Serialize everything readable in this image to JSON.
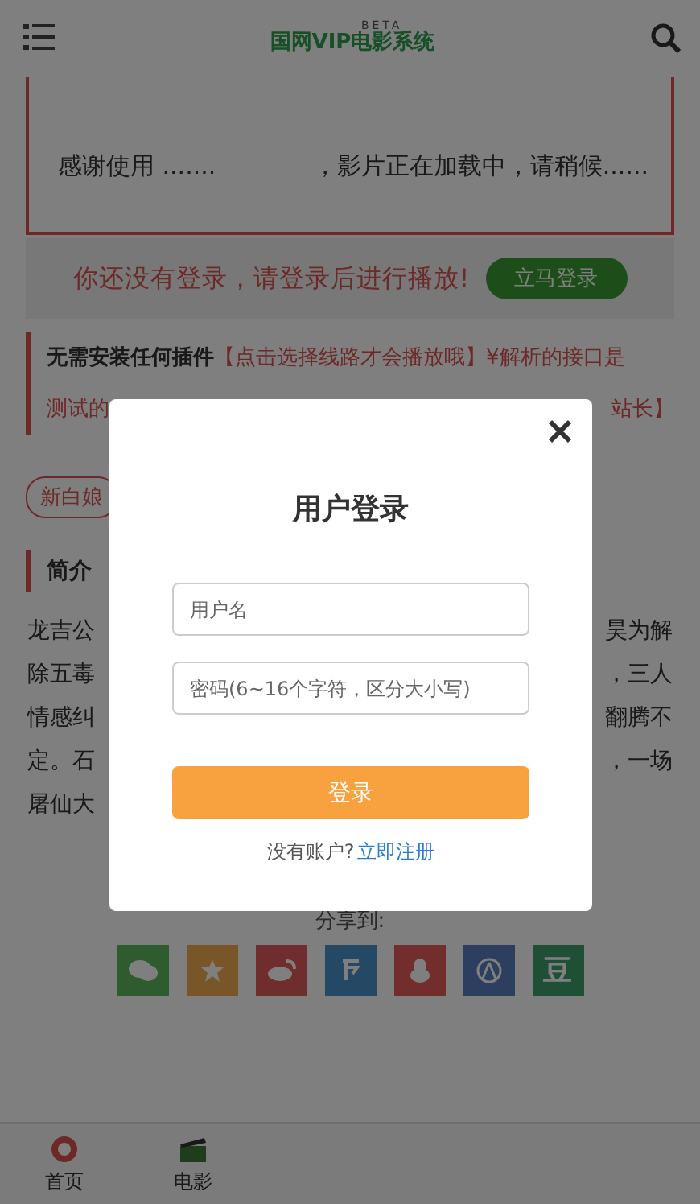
{
  "header": {
    "logo": "国网VIP电影系统",
    "logo_badge": "BETA"
  },
  "player": {
    "message_left": "感谢使用 .......",
    "message_right": "，影片正在加载中，请稍候......"
  },
  "login_bar": {
    "message": "你还没有登录，请登录后进行播放!",
    "button": "立马登录"
  },
  "notice": {
    "lead": "无需安装任何插件",
    "highlight": "【点击选择线路才会播放哦】¥解析的接口是",
    "line2_left": "测试的",
    "line2_right": "站长】"
  },
  "episode_button": "新白娘",
  "intro": {
    "heading": "简介",
    "lines": [
      {
        "left": "龙吉公",
        "right": "昊为解"
      },
      {
        "left": "除五毒",
        "right": "，三人"
      },
      {
        "left": "情感纠",
        "right": "翻腾不"
      },
      {
        "left": "定。石",
        "right": "，一场"
      },
      {
        "left": "屠仙大"
      }
    ]
  },
  "share": {
    "label": "分享到:",
    "items": [
      {
        "kind": "wechat"
      },
      {
        "kind": "qzone"
      },
      {
        "kind": "weibo"
      },
      {
        "kind": "tencent"
      },
      {
        "kind": "qq"
      },
      {
        "kind": "renren"
      },
      {
        "kind": "douban",
        "label": "豆"
      }
    ]
  },
  "bottom_nav": [
    {
      "label": "首页",
      "kind": "home"
    },
    {
      "label": "电影",
      "kind": "movie"
    }
  ],
  "login_modal": {
    "title": "用户登录",
    "username_placeholder": "用户名",
    "password_placeholder": "密码(6~16个字符，区分大小写)",
    "submit": "登录",
    "register_prompt": "没有账户?",
    "register_link": "立即注册"
  }
}
